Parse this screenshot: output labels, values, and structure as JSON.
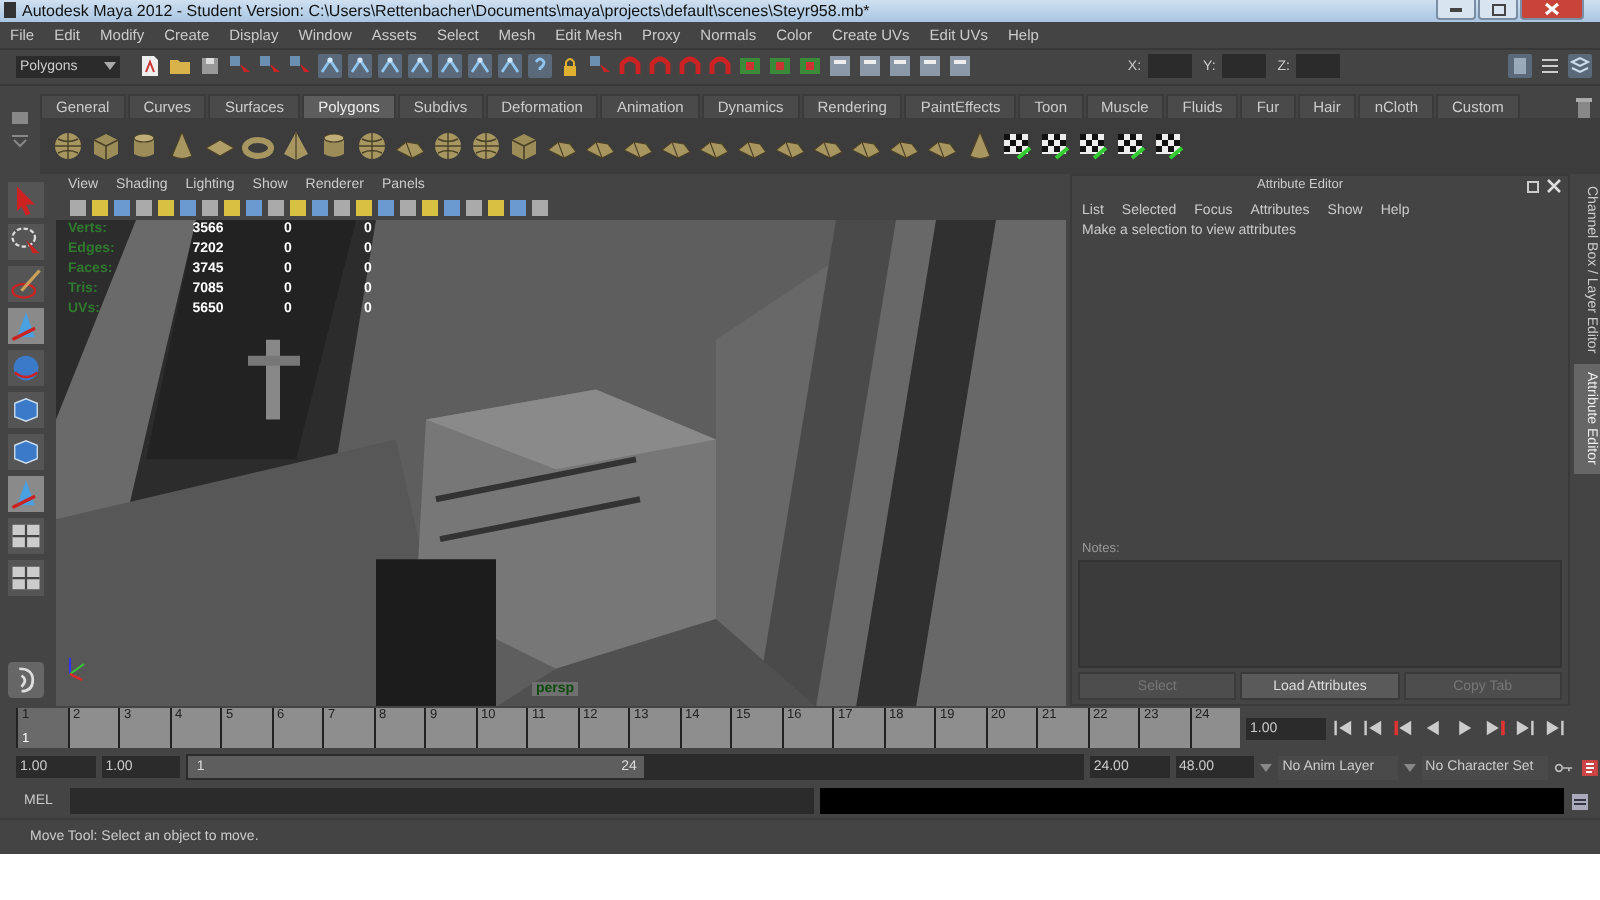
{
  "window": {
    "title": "Autodesk Maya 2012 - Student Version: C:\\Users\\Rettenbacher\\Documents\\maya\\projects\\default\\scenes\\Steyr958.mb*"
  },
  "menu_bar": [
    "File",
    "Edit",
    "Modify",
    "Create",
    "Display",
    "Window",
    "Assets",
    "Select",
    "Mesh",
    "Edit Mesh",
    "Proxy",
    "Normals",
    "Color",
    "Create UVs",
    "Edit UVs",
    "Help"
  ],
  "status_line": {
    "menu_set": "Polygons",
    "fields": [
      {
        "label": "X:"
      },
      {
        "label": "Y:"
      },
      {
        "label": "Z:"
      }
    ]
  },
  "shelf": {
    "tabs": [
      {
        "label": "General",
        "selected": false
      },
      {
        "label": "Curves",
        "selected": false
      },
      {
        "label": "Surfaces",
        "selected": false
      },
      {
        "label": "Polygons",
        "selected": true
      },
      {
        "label": "Subdivs",
        "selected": false
      },
      {
        "label": "Deformation",
        "selected": false
      },
      {
        "label": "Animation",
        "selected": false
      },
      {
        "label": "Dynamics",
        "selected": false
      },
      {
        "label": "Rendering",
        "selected": false
      },
      {
        "label": "PaintEffects",
        "selected": false
      },
      {
        "label": "Toon",
        "selected": false
      },
      {
        "label": "Muscle",
        "selected": false
      },
      {
        "label": "Fluids",
        "selected": false
      },
      {
        "label": "Fur",
        "selected": false
      },
      {
        "label": "Hair",
        "selected": false
      },
      {
        "label": "nCloth",
        "selected": false
      },
      {
        "label": "Custom",
        "selected": false
      }
    ]
  },
  "viewport": {
    "menu": [
      "View",
      "Shading",
      "Lighting",
      "Show",
      "Renderer",
      "Panels"
    ],
    "hud": [
      {
        "label": "Verts:",
        "values": [
          "3566",
          "0",
          "0"
        ]
      },
      {
        "label": "Edges:",
        "values": [
          "7202",
          "0",
          "0"
        ]
      },
      {
        "label": "Faces:",
        "values": [
          "3745",
          "0",
          "0"
        ]
      },
      {
        "label": "Tris:",
        "values": [
          "7085",
          "0",
          "0"
        ]
      },
      {
        "label": "UVs:",
        "values": [
          "5650",
          "0",
          "0"
        ]
      }
    ],
    "camera": "persp"
  },
  "attribute_editor": {
    "title": "Attribute Editor",
    "menu": [
      "List",
      "Selected",
      "Focus",
      "Attributes",
      "Show",
      "Help"
    ],
    "message": "Make a selection to view attributes",
    "notes_label": "Notes:",
    "buttons": [
      {
        "label": "Select",
        "disabled": true
      },
      {
        "label": "Load Attributes",
        "disabled": false
      },
      {
        "label": "Copy Tab",
        "disabled": true
      }
    ]
  },
  "side_tabs": [
    {
      "label": "Channel Box / Layer Editor",
      "selected": false
    },
    {
      "label": "Attribute Editor",
      "selected": true
    }
  ],
  "time_slider": {
    "ticks": [
      {
        "label": "1",
        "selected": true
      },
      {
        "label": "2",
        "selected": false
      },
      {
        "label": "3",
        "selected": false
      },
      {
        "label": "4",
        "selected": false
      },
      {
        "label": "5",
        "selected": false
      },
      {
        "label": "6",
        "selected": false
      },
      {
        "label": "7",
        "selected": false
      },
      {
        "label": "8",
        "selected": false
      },
      {
        "label": "9",
        "selected": false
      },
      {
        "label": "10",
        "selected": false
      },
      {
        "label": "11",
        "selected": false
      },
      {
        "label": "12",
        "selected": false
      },
      {
        "label": "13",
        "selected": false
      },
      {
        "label": "14",
        "selected": false
      },
      {
        "label": "15",
        "selected": false
      },
      {
        "label": "16",
        "selected": false
      },
      {
        "label": "17",
        "selected": false
      },
      {
        "label": "18",
        "selected": false
      },
      {
        "label": "19",
        "selected": false
      },
      {
        "label": "20",
        "selected": false
      },
      {
        "label": "21",
        "selected": false
      },
      {
        "label": "22",
        "selected": false
      },
      {
        "label": "23",
        "selected": false
      },
      {
        "label": "24",
        "selected": false
      }
    ],
    "current_frame": "1",
    "current_time": "1.00"
  },
  "range_slider": {
    "start_time": "1.00",
    "playback_start": "1.00",
    "range_start": "1",
    "range_end": "24",
    "playback_end": "24.00",
    "end_time": "48.00",
    "anim_layer": "No Anim Layer",
    "character_set": "No Character Set"
  },
  "command_line": {
    "language": "MEL"
  },
  "help_line": "Move Tool: Select an object to move."
}
